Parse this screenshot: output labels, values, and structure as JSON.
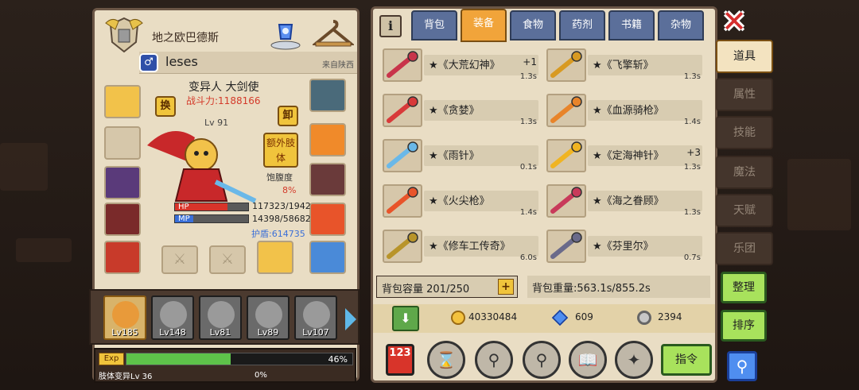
{
  "player": {
    "guild_name": "地之欧巴德斯",
    "gender_icon": "male-icon",
    "name": "leses",
    "from": "来自陕西",
    "class": "变异人 大剑使",
    "power": "战斗力:1188166",
    "level": "Lv 91",
    "swap_label": "换",
    "unequip_label": "卸",
    "extra_limb_label": "额外肢体",
    "hunger_label": "饱腹度",
    "hunger_value": "8%",
    "hp_label": "HP",
    "hp_text": "117323/1942",
    "hp_fraction": 0.72,
    "mp_label": "MP",
    "mp_text": "14398/58682",
    "mp_fraction": 0.25,
    "shield_text": "护盾:614735"
  },
  "team": [
    {
      "level": "Lv185",
      "active": true
    },
    {
      "level": "Lv148",
      "active": false
    },
    {
      "level": "Lv81",
      "active": false
    },
    {
      "level": "Lv89",
      "active": false
    },
    {
      "level": "Lv107",
      "active": false
    }
  ],
  "exp": {
    "tag": "Exp",
    "percent": "46%",
    "fraction": 0.46,
    "limb_label": "肢体变异Lv 36",
    "limb_percent": "0%"
  },
  "tabs": [
    "背包",
    "装备",
    "食物",
    "药剂",
    "书籍",
    "杂物"
  ],
  "active_tab": 1,
  "items": [
    {
      "name": "★《大荒幻神》",
      "plus": "+1",
      "time": "1.3s",
      "color": "#c8344a"
    },
    {
      "name": "★《飞擎斩》",
      "plus": "",
      "time": "1.3s",
      "color": "#d89a22"
    },
    {
      "name": "★《贪婪》",
      "plus": "",
      "time": "1.3s",
      "color": "#d83a3a"
    },
    {
      "name": "★《血源骑枪》",
      "plus": "",
      "time": "1.4s",
      "color": "#e8842a"
    },
    {
      "name": "★《雨针》",
      "plus": "",
      "time": "0.1s",
      "color": "#6ab8e8"
    },
    {
      "name": "★《定海神针》",
      "plus": "+3",
      "time": "1.3s",
      "color": "#f0b422"
    },
    {
      "name": "★《火尖枪》",
      "plus": "",
      "time": "1.4s",
      "color": "#e8542a"
    },
    {
      "name": "★《海之眷顾》",
      "plus": "",
      "time": "1.3s",
      "color": "#c83a5a"
    },
    {
      "name": "★《修车工传奇》",
      "plus": "",
      "time": "6.0s",
      "color": "#b8942a"
    },
    {
      "name": "★《芬里尔》",
      "plus": "",
      "time": "0.7s",
      "color": "#6a6a8a"
    }
  ],
  "bag": {
    "capacity": "背包容量 201/250",
    "plus": "+",
    "weight": "背包重量:563.1s/855.2s"
  },
  "currency": {
    "gold": "40330484",
    "gems": "609",
    "silver": "2394"
  },
  "tools": {
    "sort_label": "123",
    "command_label": "指令"
  },
  "side_menu": [
    {
      "label": "道具",
      "active": true
    },
    {
      "label": "属性",
      "active": false
    },
    {
      "label": "技能",
      "active": false
    },
    {
      "label": "魔法",
      "active": false
    },
    {
      "label": "天赋",
      "active": false
    },
    {
      "label": "乐团",
      "active": false
    }
  ],
  "side_buttons": {
    "organize": "整理",
    "sort": "排序"
  }
}
